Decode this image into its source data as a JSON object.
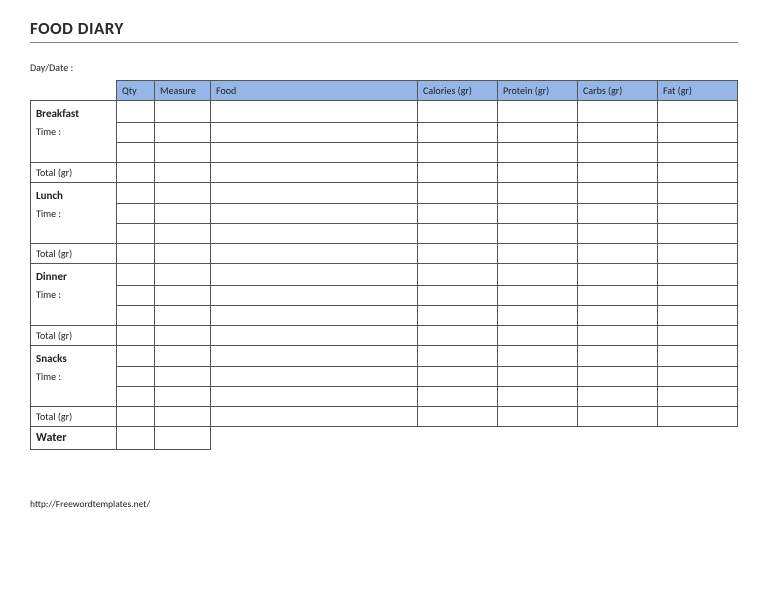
{
  "title": "FOOD DIARY",
  "day_date_label": "Day/Date :",
  "headers": {
    "qty": "Qty",
    "measure": "Measure",
    "food": "Food",
    "calories": "Calories (gr)",
    "protein": "Protein (gr)",
    "carbs": "Carbs (gr)",
    "fat": "Fat (gr)"
  },
  "sections": {
    "breakfast": {
      "label": "Breakfast",
      "time": "Time :",
      "total": "Total (gr)"
    },
    "lunch": {
      "label": "Lunch",
      "time": "Time :",
      "total": "Total (gr)"
    },
    "dinner": {
      "label": "Dinner",
      "time": "Time :",
      "total": "Total (gr)"
    },
    "snacks": {
      "label": "Snacks",
      "time": "Time :",
      "total": "Total (gr)"
    },
    "water": {
      "label": "Water"
    }
  },
  "footer_url": "http://Freewordtemplates.net/"
}
